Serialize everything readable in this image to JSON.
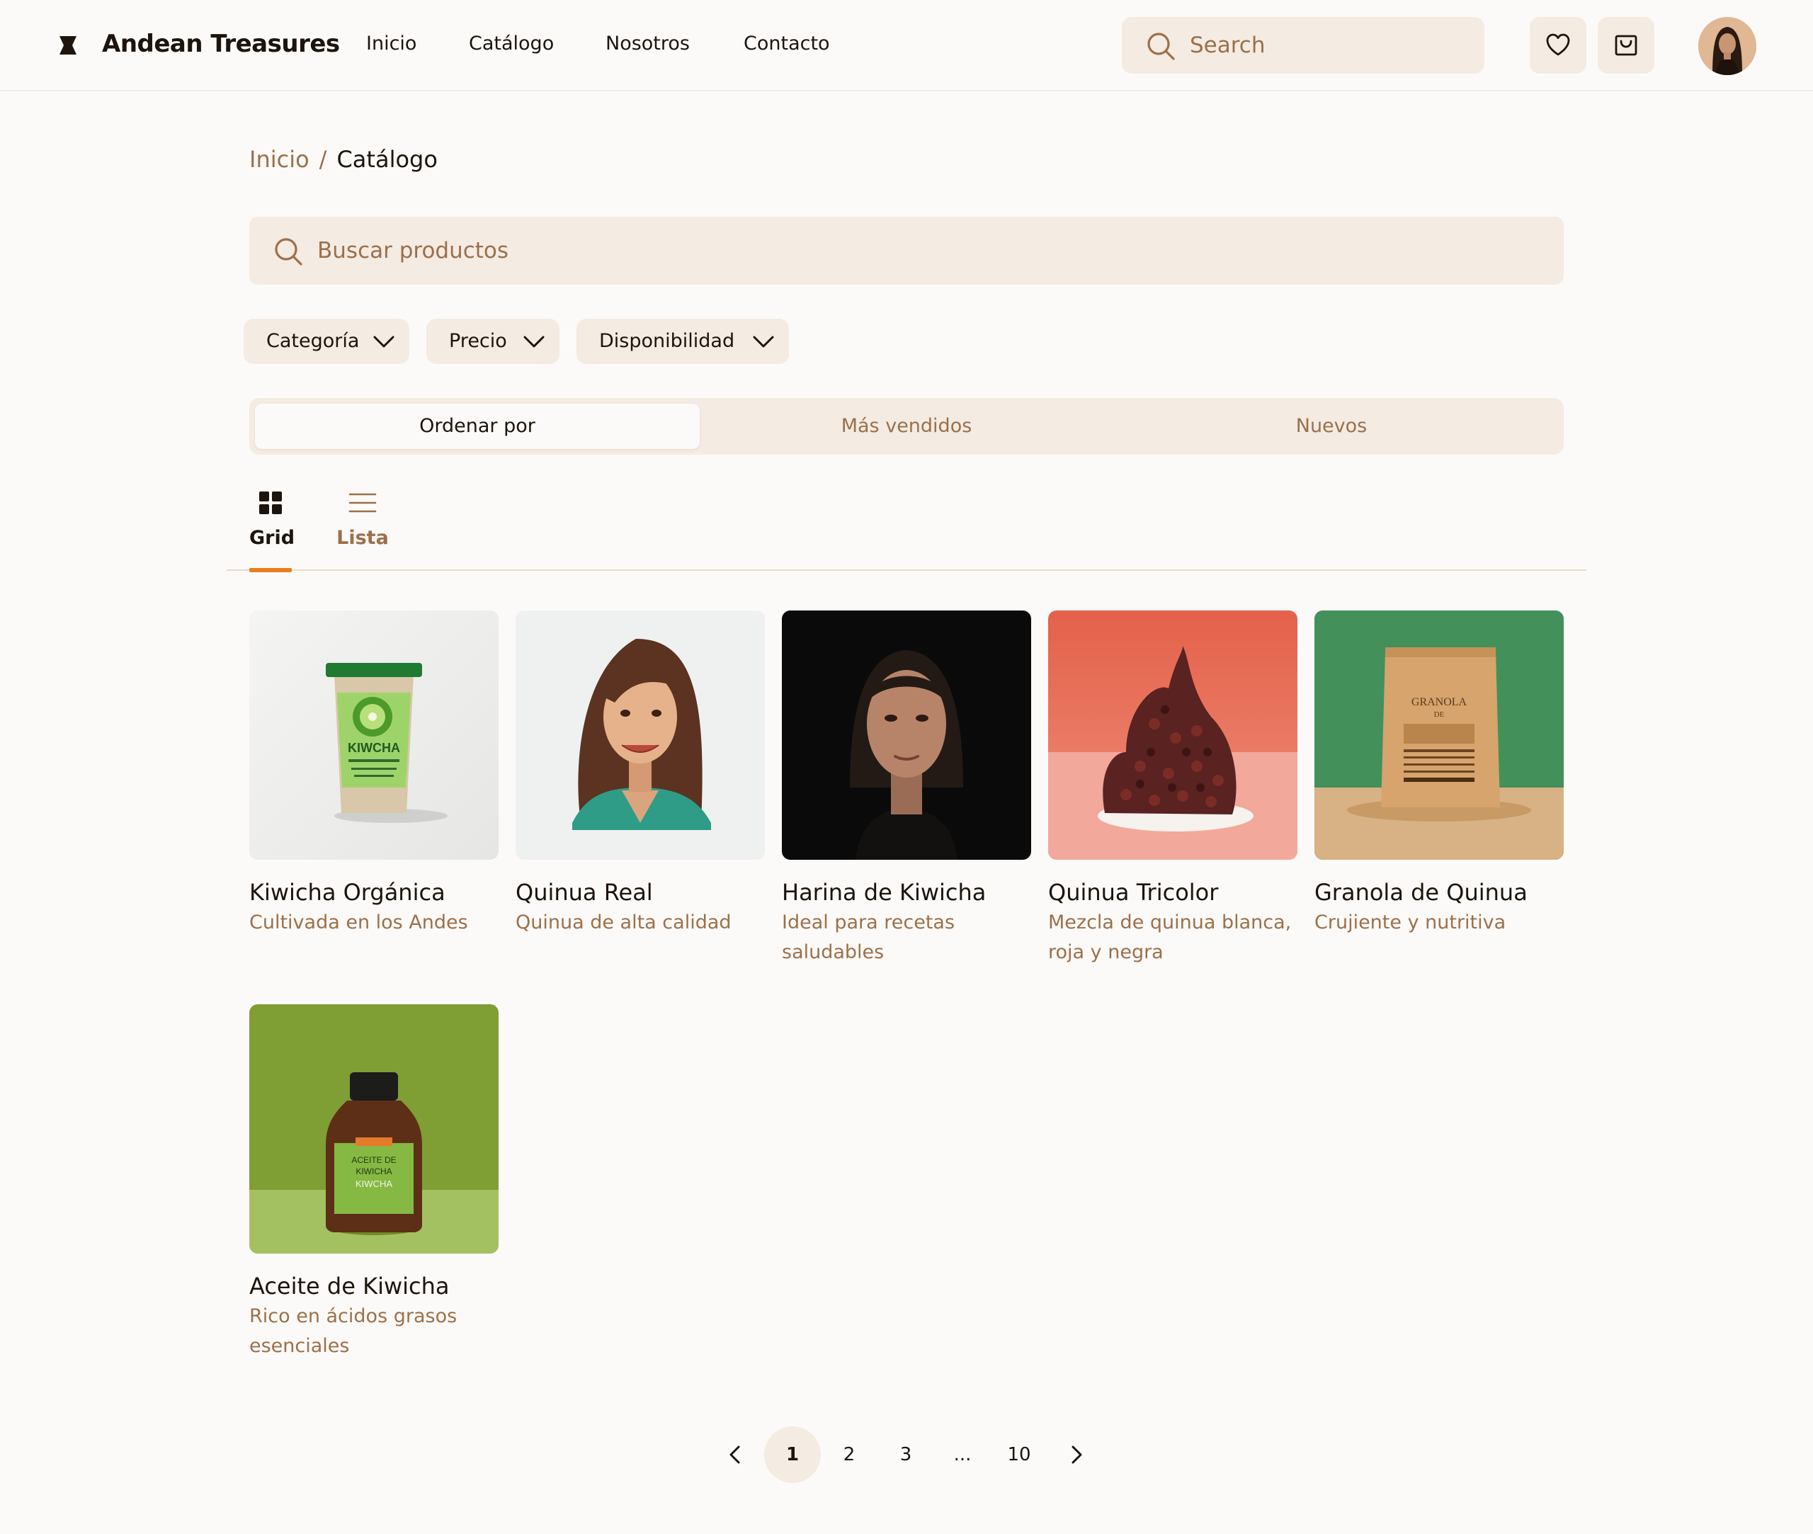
{
  "header": {
    "brand": "Andean Treasures",
    "nav": [
      "Inicio",
      "Catálogo",
      "Nosotros",
      "Contacto"
    ],
    "search_placeholder": "Search"
  },
  "breadcrumb": {
    "home": "Inicio",
    "separator": "/",
    "current": "Catálogo"
  },
  "search": {
    "placeholder": "Buscar productos"
  },
  "filters": [
    "Categoría",
    "Precio",
    "Disponibilidad"
  ],
  "sort": {
    "options": [
      "Ordenar por",
      "Más vendidos",
      "Nuevos"
    ],
    "active_index": 0
  },
  "view_tabs": {
    "grid": "Grid",
    "list": "Lista",
    "active": "Grid"
  },
  "products": [
    {
      "name": "Kiwicha Orgánica",
      "desc": "Cultivada en los Andes"
    },
    {
      "name": "Quinua Real",
      "desc": "Quinua de alta calidad"
    },
    {
      "name": "Harina de Kiwicha",
      "desc": "Ideal para recetas saludables"
    },
    {
      "name": "Quinua Tricolor",
      "desc": "Mezcla de quinua blanca, roja y negra"
    },
    {
      "name": "Granola de Quinua",
      "desc": "Crujiente y nutritiva"
    },
    {
      "name": "Aceite de Kiwicha",
      "desc": "Rico en ácidos grasos esenciales"
    }
  ],
  "product_image_labels": {
    "kiwicha_cup": "KIWCHA",
    "granola_bag_1": "GRANOLA",
    "granola_bag_2": "DE",
    "oil_bottle_1": "ACEITE DE",
    "oil_bottle_2": "KIWICHA",
    "oil_bottle_3": "KIWCHA"
  },
  "pagination": {
    "pages": [
      "1",
      "2",
      "3",
      "...",
      "10"
    ],
    "current": "1"
  },
  "colors": {
    "background": "#fcfaf8",
    "surface": "#f4ebe3",
    "text": "#1c140d",
    "muted": "#9c704a",
    "accent": "#e87f1f"
  },
  "icons": [
    "logo-icon",
    "search-icon",
    "heart-icon",
    "shopping-bag-icon",
    "chevron-down-icon",
    "grid-icon",
    "list-icon",
    "chevron-left-icon",
    "chevron-right-icon"
  ]
}
